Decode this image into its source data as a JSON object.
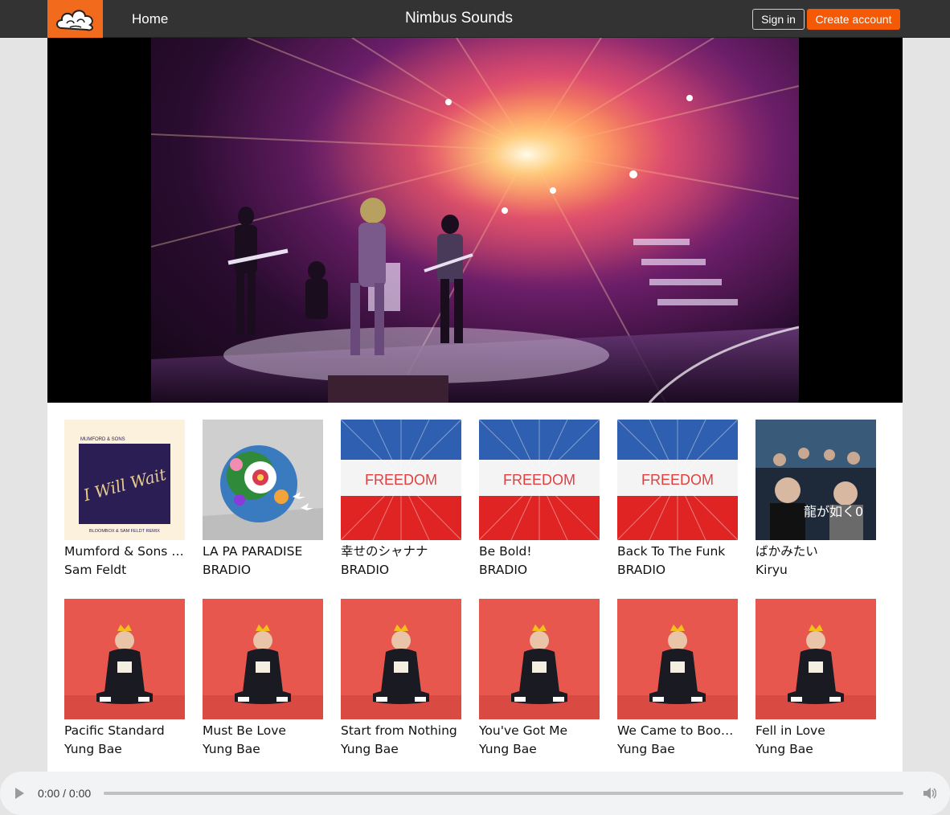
{
  "header": {
    "home_label": "Home",
    "site_title": "Nimbus Sounds",
    "signin_label": "Sign in",
    "create_account_label": "Create account",
    "logo_icon": "cloud-logo-icon",
    "accent_color": "#f45a05"
  },
  "tracks": [
    {
      "title": "Mumford & Sons - I Will Wait (Sam Feldt Remix)",
      "artist": "Sam Feldt",
      "cover": "i-will-wait",
      "cover_text": "I Will Wait",
      "cover_band": "MUMFORD & SONS",
      "cover_sub": "BLOOMBOX & SAM FELDT REMIX"
    },
    {
      "title": "LA PA PARADISE",
      "artist": "BRADIO",
      "cover": "flower-globe"
    },
    {
      "title": "幸せのシャナナ",
      "artist": "BRADIO",
      "cover": "freedom",
      "cover_text": "FREEDOM"
    },
    {
      "title": "Be Bold!",
      "artist": "BRADIO",
      "cover": "freedom",
      "cover_text": "FREEDOM"
    },
    {
      "title": "Back To The Funk",
      "artist": "BRADIO",
      "cover": "freedom",
      "cover_text": "FREEDOM"
    },
    {
      "title": "ばかみたい",
      "artist": "Kiryu",
      "cover": "yakuza",
      "cover_text": "龍が如く0"
    },
    {
      "title": "Pacific Standard",
      "artist": "Yung Bae",
      "cover": "yung-bae"
    },
    {
      "title": "Must Be Love",
      "artist": "Yung Bae",
      "cover": "yung-bae"
    },
    {
      "title": "Start from Nothing",
      "artist": "Yung Bae",
      "cover": "yung-bae"
    },
    {
      "title": "You've Got Me",
      "artist": "Yung Bae",
      "cover": "yung-bae"
    },
    {
      "title": "We Came to Boogie",
      "artist": "Yung Bae",
      "cover": "yung-bae"
    },
    {
      "title": "Fell in Love",
      "artist": "Yung Bae",
      "cover": "yung-bae"
    }
  ],
  "player": {
    "time": "0:00 / 0:00",
    "progress": 0,
    "play_icon": "play-icon",
    "volume_icon": "volume-icon"
  }
}
